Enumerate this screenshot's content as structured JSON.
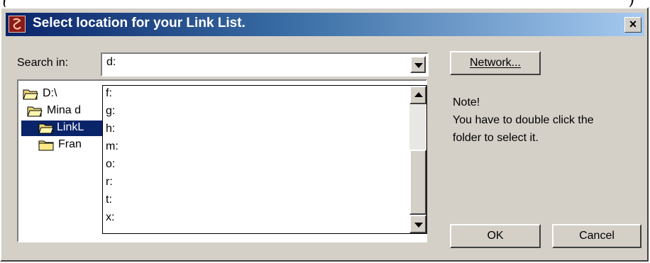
{
  "window": {
    "title": "Select location for your Link List.",
    "close_glyph": "×",
    "title_icon": "app-icon"
  },
  "top_strip": {
    "left_text": "(",
    "right_text": ")"
  },
  "search": {
    "label": "Search in:",
    "value": "d:"
  },
  "tree": {
    "items": [
      {
        "label": "D:\\",
        "icon": "open-folder-icon",
        "selected": false
      },
      {
        "label": "Mina d",
        "icon": "open-folder-icon",
        "selected": false
      },
      {
        "label": "LinkL",
        "icon": "open-folder-icon",
        "selected": true
      },
      {
        "label": "Fran",
        "icon": "folder-icon",
        "selected": false
      }
    ]
  },
  "dropdown": {
    "options": [
      "f:",
      "g:",
      "h:",
      "m:",
      "o:",
      "r:",
      "t:",
      "x:"
    ]
  },
  "buttons": {
    "network": "Network...",
    "ok": "OK",
    "cancel": "Cancel"
  },
  "note": {
    "heading": "Note!",
    "line1": "You have to double click the",
    "line2": "folder to select it."
  },
  "colors": {
    "titlebar_start": "#0a246a",
    "titlebar_end": "#a6caf0",
    "face": "#d4d0c8",
    "selection": "#0a246a"
  }
}
